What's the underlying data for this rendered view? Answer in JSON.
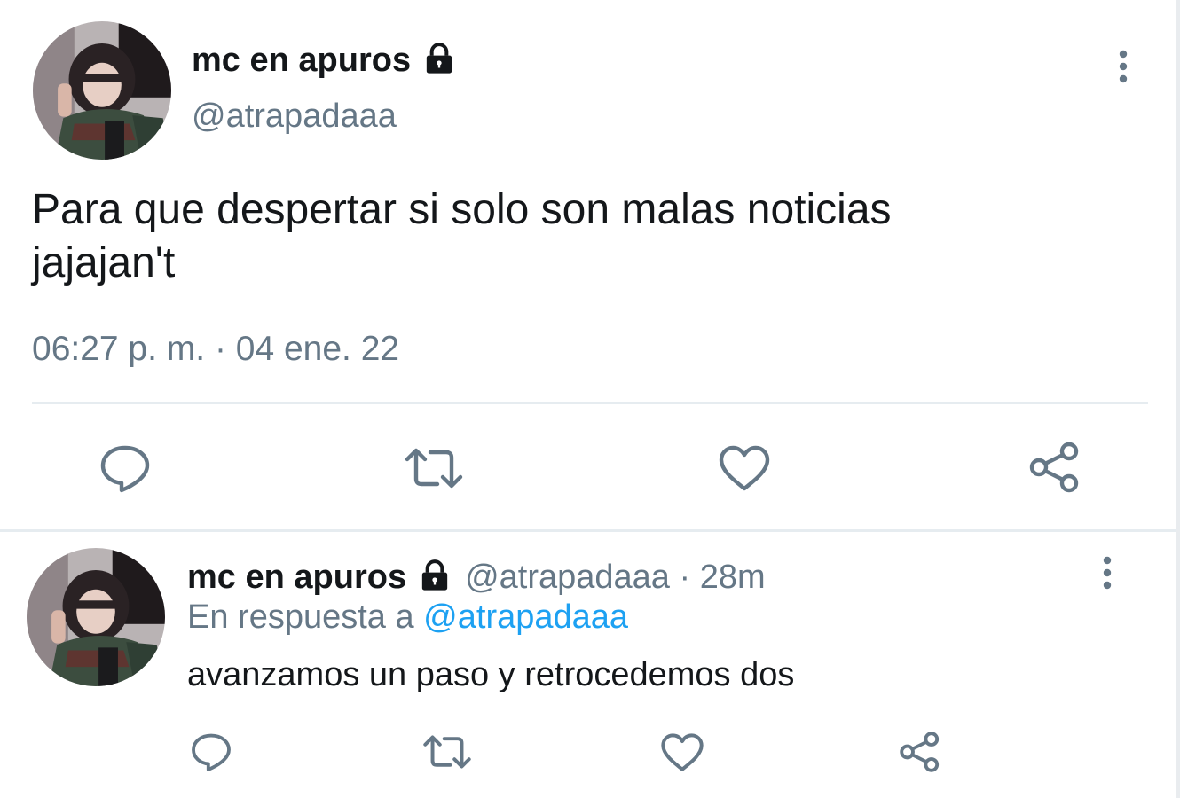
{
  "main_tweet": {
    "author_name": "mc en apuros",
    "protected_icon": "lock-icon",
    "handle": "@atrapadaaa",
    "more_icon": "more-vertical-icon",
    "text_line1": "Para que despertar si solo son malas noticias",
    "text_line2": "jajajan't",
    "timestamp": "06:27 p. m. · 04 ene. 22",
    "actions": [
      "reply-icon",
      "retweet-icon",
      "like-icon",
      "share-icon"
    ]
  },
  "reply_tweet": {
    "author_name": "mc en apuros",
    "protected_icon": "lock-icon",
    "handle_time": "@atrapadaaa · 28m",
    "more_icon": "more-vertical-icon",
    "reply_prefix": "En respuesta a",
    "reply_mention": "@atrapadaaa",
    "text": "avanzamos un paso y retrocedemos dos",
    "actions": [
      "reply-icon",
      "retweet-icon",
      "like-icon",
      "share-icon"
    ]
  },
  "colors": {
    "primary_text": "#14171a",
    "secondary_text": "#657786",
    "link": "#1da1f2",
    "divider": "#e6ecf0"
  }
}
